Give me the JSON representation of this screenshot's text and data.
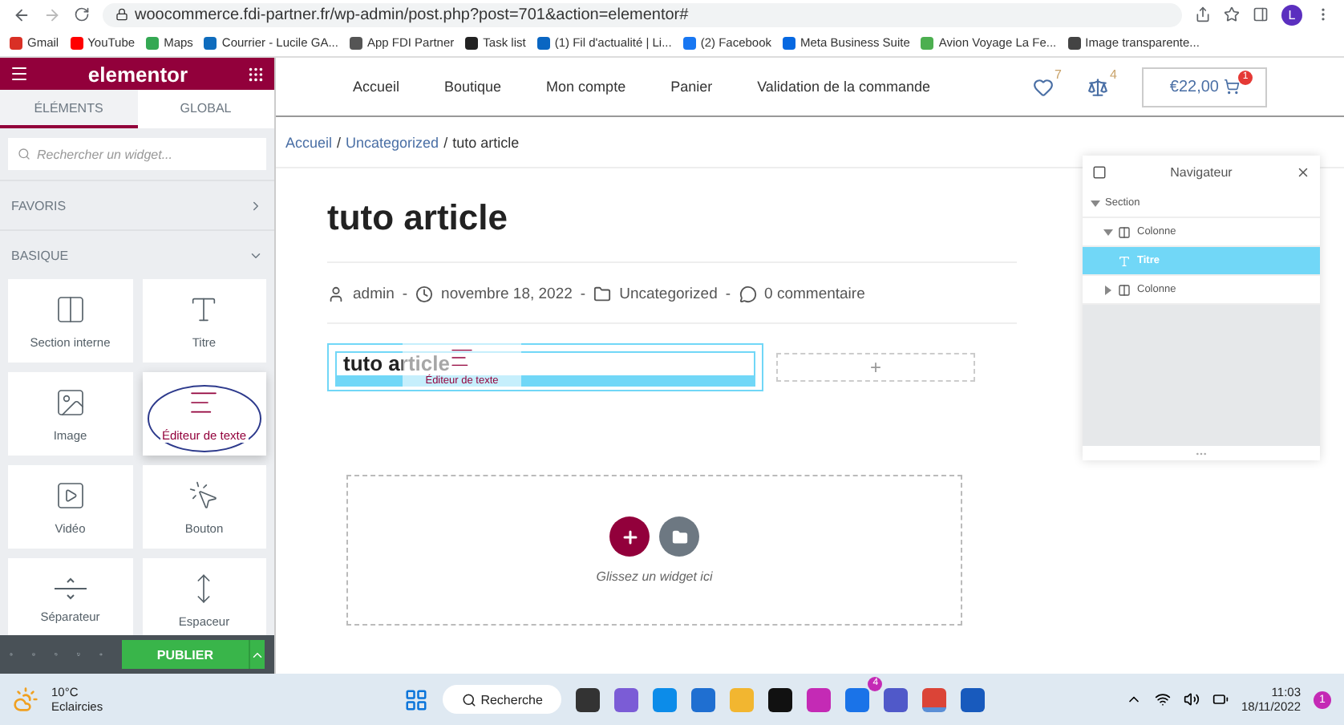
{
  "browser": {
    "url": "woocommerce.fdi-partner.fr/wp-admin/post.php?post=701&action=elementor#",
    "profile": "L",
    "bookmarks": [
      {
        "label": "Gmail",
        "color": "#d93025"
      },
      {
        "label": "YouTube",
        "color": "#ff0000"
      },
      {
        "label": "Maps",
        "color": "#34a853"
      },
      {
        "label": "Courrier - Lucile GA...",
        "color": "#0f6cbd"
      },
      {
        "label": "App FDI Partner",
        "color": "#555555"
      },
      {
        "label": "Task list",
        "color": "#222222"
      },
      {
        "label": "(1) Fil d'actualité | Li...",
        "color": "#0a66c2"
      },
      {
        "label": "(2) Facebook",
        "color": "#1877f2"
      },
      {
        "label": "Meta Business Suite",
        "color": "#0668e1"
      },
      {
        "label": "Avion Voyage La Fe...",
        "color": "#4caf50"
      },
      {
        "label": "Image transparente...",
        "color": "#444444"
      }
    ]
  },
  "panel": {
    "brand": "elementor",
    "tabs": [
      {
        "label": "ÉLÉMENTS",
        "selected": true
      },
      {
        "label": "GLOBAL",
        "selected": false
      }
    ],
    "search": {
      "placeholder": "Rechercher un widget..."
    },
    "categories": [
      {
        "label": "FAVORIS",
        "expanded": false
      },
      {
        "label": "BASIQUE",
        "expanded": true
      }
    ],
    "widgets": [
      {
        "label": "Section interne",
        "kind": "columns",
        "selected": false
      },
      {
        "label": "Titre",
        "kind": "heading",
        "selected": false
      },
      {
        "label": "Image",
        "kind": "image",
        "selected": false
      },
      {
        "label": "Éditeur de texte",
        "kind": "text",
        "selected": true
      },
      {
        "label": "Vidéo",
        "kind": "video",
        "selected": false
      },
      {
        "label": "Bouton",
        "kind": "button",
        "selected": false
      },
      {
        "label": "Séparateur",
        "kind": "divider",
        "selected": false
      },
      {
        "label": "Espaceur",
        "kind": "spacer",
        "selected": false
      }
    ],
    "publish": "PUBLIER"
  },
  "site": {
    "menu": [
      "Accueil",
      "Boutique",
      "Mon compte",
      "Panier",
      "Validation de la commande"
    ],
    "wishlist_count": "7",
    "compare_count": "4",
    "cart_total": "€22,00",
    "cart_count": "1",
    "breadcrumb": {
      "links": [
        "Accueil",
        "Uncategorized"
      ],
      "current": "tuto article",
      "separator": "/"
    },
    "title": "tuto article",
    "meta": {
      "author": "admin",
      "date": "novembre 18, 2022",
      "category": "Uncategorized",
      "comments": "0 commentaire",
      "separator": "-"
    },
    "editing": {
      "heading": "tuto article",
      "dragged_widget": "Éditeur de texte",
      "add": "+"
    },
    "drop_zone": {
      "hint": "Glissez un widget ici"
    }
  },
  "navigator": {
    "title": "Navigateur",
    "tree": [
      {
        "label": "Section",
        "expanded": true,
        "selected": false,
        "children": [
          {
            "label": "Colonne",
            "kind": "column",
            "expanded": true,
            "selected": false,
            "children": [
              {
                "label": "Titre",
                "kind": "heading",
                "selected": true
              }
            ]
          },
          {
            "label": "Colonne",
            "kind": "column",
            "expanded": false,
            "selected": false
          }
        ]
      }
    ]
  },
  "taskbar": {
    "weather": {
      "temp": "10°C",
      "desc": "Eclaircies"
    },
    "search": "Recherche",
    "apps": [
      {
        "color": "#333333",
        "selected": false
      },
      {
        "color": "#7b5cd6",
        "selected": false
      },
      {
        "color": "#0c8ce9",
        "selected": false
      },
      {
        "color": "#1f6fd1",
        "selected": false
      },
      {
        "color": "#f2b630",
        "selected": false
      },
      {
        "color": "#111111",
        "selected": false
      },
      {
        "color": "#c42ab5",
        "selected": false
      },
      {
        "color": "#1a73e8",
        "selected": false,
        "badge": "4"
      },
      {
        "color": "#5059c9",
        "selected": false
      },
      {
        "color": "#db4437",
        "selected": true
      },
      {
        "color": "#185abd",
        "selected": false
      }
    ],
    "time": "11:03",
    "date": "18/11/2022",
    "notifications": "1"
  }
}
